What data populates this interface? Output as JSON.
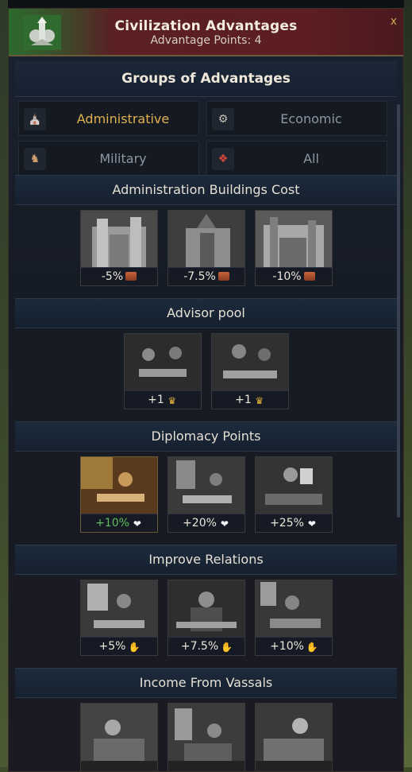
{
  "window": {
    "title": "Civilization Advantages",
    "subtitle": "Advantage Points: 4",
    "close_label": "x"
  },
  "groups": {
    "title": "Groups of Advantages",
    "items": [
      {
        "label": "Administrative",
        "icon": "building-icon",
        "active": true
      },
      {
        "label": "Economic",
        "icon": "cart-icon",
        "active": false
      },
      {
        "label": "Military",
        "icon": "soldier-icon",
        "active": false
      },
      {
        "label": "All",
        "icon": "scroll-icon",
        "active": false
      }
    ]
  },
  "sections": [
    {
      "title": "Administration Buildings Cost",
      "cards": [
        {
          "value": "-5%",
          "icon": "brick-icon"
        },
        {
          "value": "-7.5%",
          "icon": "brick-icon"
        },
        {
          "value": "-10%",
          "icon": "brick-icon"
        }
      ]
    },
    {
      "title": "Advisor pool",
      "cards": [
        {
          "value": "+1",
          "icon": "crown-icon"
        },
        {
          "value": "+1",
          "icon": "crown-icon"
        }
      ]
    },
    {
      "title": "Diplomacy Points",
      "cards": [
        {
          "value": "+10%",
          "icon": "dove-icon",
          "selected": true
        },
        {
          "value": "+20%",
          "icon": "dove-icon"
        },
        {
          "value": "+25%",
          "icon": "dove-icon"
        }
      ]
    },
    {
      "title": "Improve Relations",
      "cards": [
        {
          "value": "+5%",
          "icon": "handshake-icon"
        },
        {
          "value": "+7.5%",
          "icon": "handshake-icon"
        },
        {
          "value": "+10%",
          "icon": "handshake-icon"
        }
      ]
    },
    {
      "title": "Income From Vassals",
      "cards": [
        {
          "value": "",
          "icon": ""
        },
        {
          "value": "",
          "icon": ""
        },
        {
          "value": "",
          "icon": ""
        }
      ]
    }
  ],
  "colors": {
    "active_group": "#e0b050",
    "selected_value": "#5fbf5a",
    "title_bar": "#5c1e22"
  }
}
